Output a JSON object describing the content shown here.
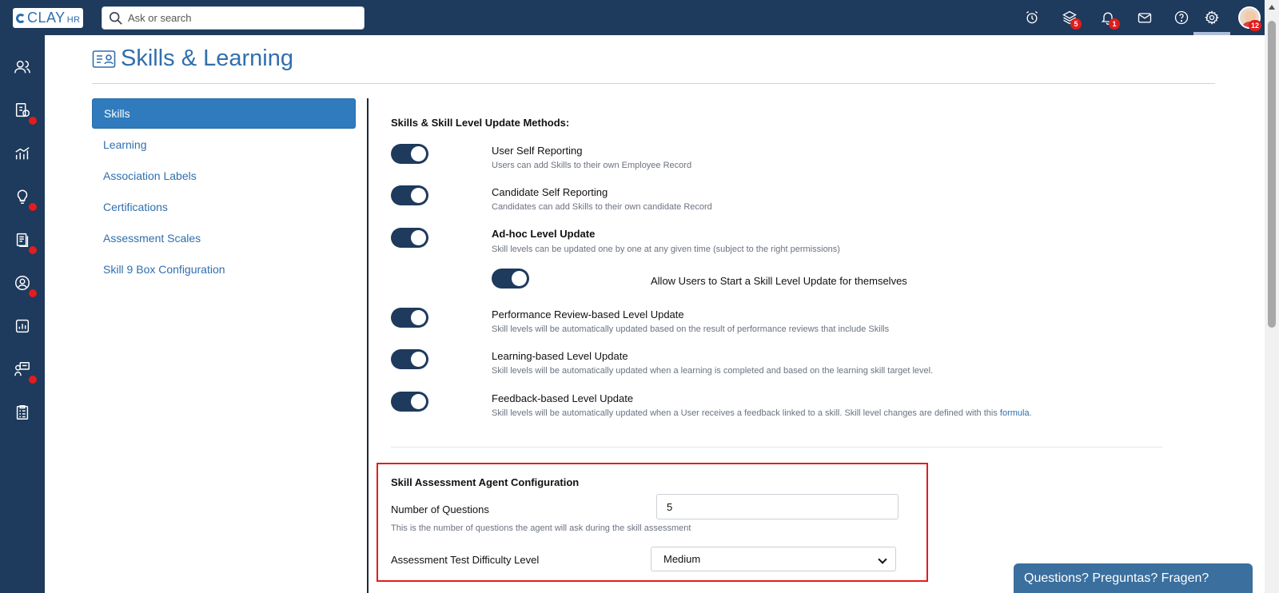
{
  "app": {
    "logo_text": "CLAY",
    "logo_suffix": "HR"
  },
  "search": {
    "placeholder": "Ask or search"
  },
  "topbar": {
    "icons": [
      {
        "name": "alarm-clock-icon"
      },
      {
        "name": "layers-icon",
        "badge": "5"
      },
      {
        "name": "bell-icon",
        "badge": "1"
      },
      {
        "name": "mail-icon"
      },
      {
        "name": "help-icon"
      },
      {
        "name": "gear-icon"
      }
    ],
    "avatar_badge": "12"
  },
  "rail": [
    {
      "name": "people-icon",
      "dot": false
    },
    {
      "name": "payroll-icon",
      "dot": true
    },
    {
      "name": "growth-chart-icon",
      "dot": false
    },
    {
      "name": "lightbulb-icon",
      "dot": true
    },
    {
      "name": "documents-icon",
      "dot": true
    },
    {
      "name": "user-circle-icon",
      "dot": true
    },
    {
      "name": "reports-icon",
      "dot": false
    },
    {
      "name": "training-icon",
      "dot": true
    },
    {
      "name": "clipboard-icon",
      "dot": false
    }
  ],
  "page": {
    "title": "Skills & Learning"
  },
  "subnav": {
    "items": [
      "Skills",
      "Learning",
      "Association Labels",
      "Certifications",
      "Assessment Scales",
      "Skill 9 Box Configuration"
    ],
    "active_index": 0
  },
  "methods": {
    "title": "Skills & Skill Level Update Methods:",
    "options": [
      {
        "label": "User Self Reporting",
        "desc": "Users can add Skills to their own Employee Record",
        "enabled": true
      },
      {
        "label": "Candidate Self Reporting",
        "desc": "Candidates can add Skills to their own candidate Record",
        "enabled": true
      },
      {
        "label": "Ad-hoc Level Update",
        "desc": "Skill levels can be updated one by one at any given time (subject to the right permissions)",
        "enabled": true
      },
      {
        "label": "Performance Review-based Level Update",
        "desc": "Skill levels will be automatically updated based on the result of performance reviews that include Skills",
        "enabled": true
      },
      {
        "label": "Learning-based Level Update",
        "desc": "Skill levels will be automatically updated when a learning is completed and based on the learning skill target level.",
        "enabled": true
      },
      {
        "label": "Feedback-based Level Update",
        "desc": "Skill levels will be automatically updated when a User receives a feedback linked to a skill. Skill level changes are defined with this ",
        "link": "formula",
        "desc_end": ".",
        "enabled": true
      }
    ],
    "sub_option": {
      "label": "Allow Users to Start a Skill Level Update for themselves",
      "enabled": true
    }
  },
  "agent": {
    "title": "Skill Assessment Agent Configuration",
    "questions_label": "Number of Questions",
    "questions_value": "5",
    "questions_desc": "This is the number of questions the agent will ask during the skill assessment",
    "difficulty_label": "Assessment Test Difficulty Level",
    "difficulty_value": "Medium"
  },
  "help_widget": {
    "label": "Questions? Preguntas? Fragen?"
  },
  "colors": {
    "navy": "#1e3a5c",
    "accent": "#2f6fae",
    "badge": "#e11d1d"
  }
}
